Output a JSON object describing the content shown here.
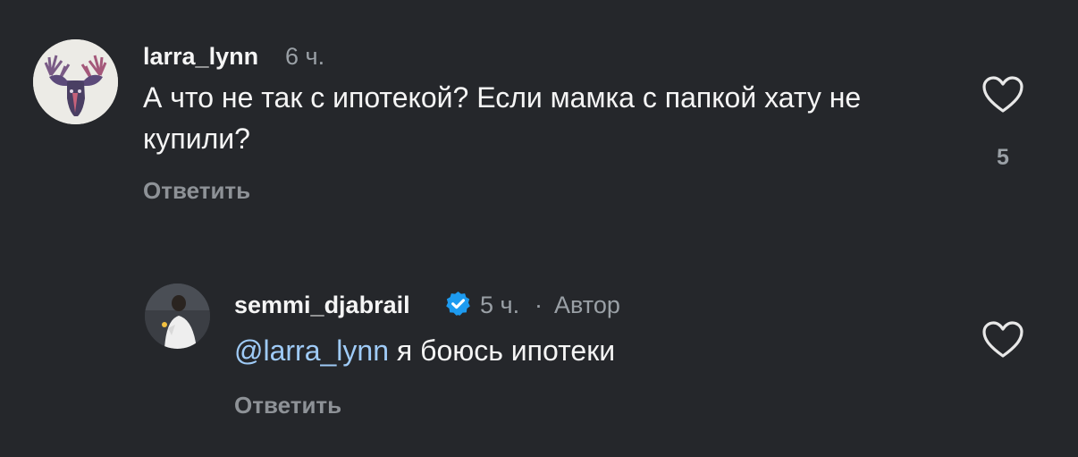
{
  "comments": [
    {
      "username": "larra_lynn",
      "time": "6 ч.",
      "text": "А что не так с ипотекой? Если мамка с папкой хату не купили?",
      "reply_label": "Ответить",
      "likes": "5",
      "avatar_icon": "moose-illustration-avatar"
    },
    {
      "username": "semmi_djabrail",
      "verified": true,
      "time": "5 ч.",
      "separator": "·",
      "author_label": "Автор",
      "mention": "@larra_lynn",
      "text": " я боюсь ипотеки",
      "reply_label": "Ответить",
      "avatar_icon": "person-photo-avatar"
    }
  ],
  "colors": {
    "background": "#25272b",
    "text": "#f5f5f5",
    "secondary": "#9aa0a6",
    "mention": "#9fcbf7",
    "verified": "#1d9bf0"
  }
}
